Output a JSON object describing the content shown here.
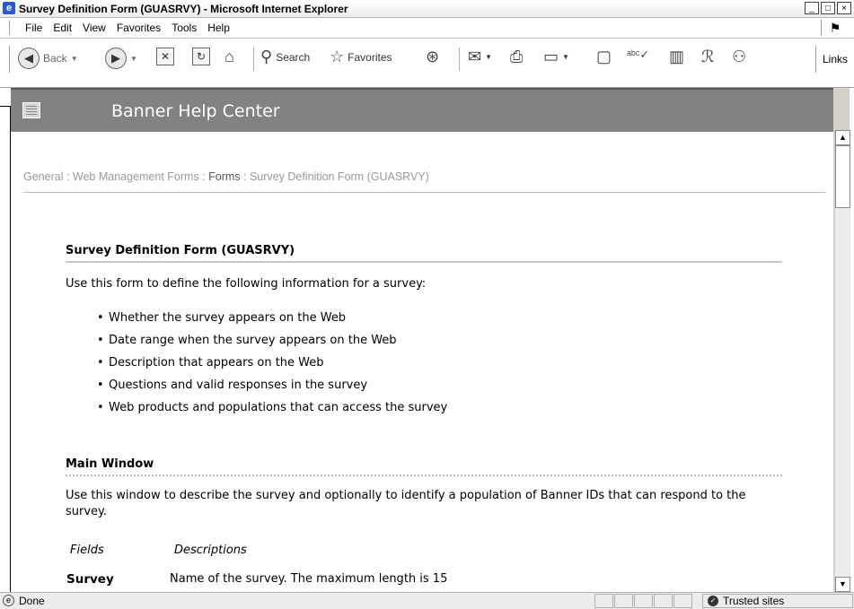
{
  "window": {
    "title": "Survey Definition Form (GUASRVY) - Microsoft Internet Explorer",
    "controls": {
      "minimize": "_",
      "maximize": "□",
      "close": "×"
    }
  },
  "menubar": {
    "items": [
      "File",
      "Edit",
      "View",
      "Favorites",
      "Tools",
      "Help"
    ]
  },
  "toolbar": {
    "back_label": "Back",
    "search_label": "Search",
    "favorites_label": "Favorites",
    "links_label": "Links"
  },
  "banner": {
    "title": "Banner Help Center"
  },
  "breadcrumb": {
    "general": "General",
    "web_management": "Web Management Forms",
    "forms": "Forms",
    "current": "Survey Definition Form (GUASRVY)",
    "separator": " : "
  },
  "main": {
    "heading": "Survey Definition Form (GUASRVY)",
    "intro": "Use this form to define the following information for a survey:",
    "bullets": [
      "Whether the survey appears on the Web",
      "Date range when the survey appears on the Web",
      "Description that appears on the Web",
      "Questions and valid responses in the survey",
      "Web products and populations that can access the survey"
    ],
    "section_heading": "Main Window",
    "section_text": "Use this window to describe the survey and optionally to identify a population of Banner IDs that can respond to the survey.",
    "fields_header": "Fields",
    "descriptions_header": "Descriptions",
    "field_survey_name": "Survey",
    "field_survey_desc": "Name of the survey. The maximum length is 15"
  },
  "status": {
    "text": "Done",
    "zone": "Trusted sites"
  }
}
